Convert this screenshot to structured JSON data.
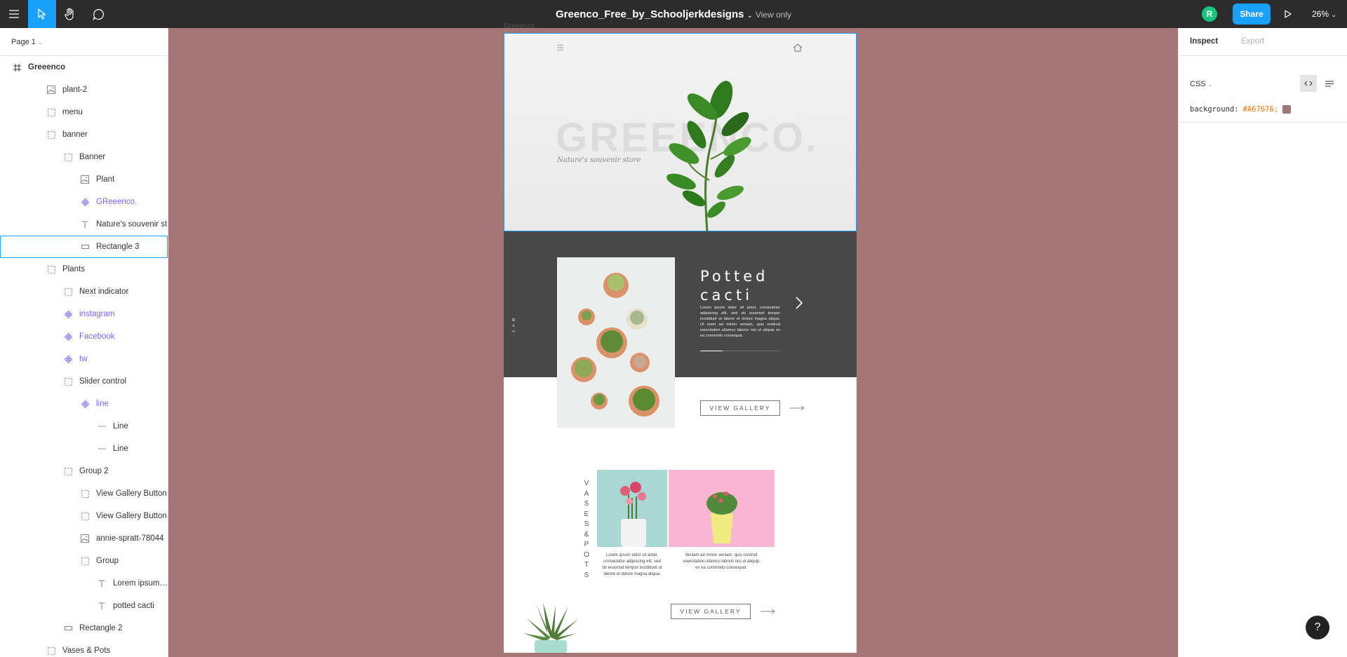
{
  "toolbar": {
    "file_name": "Greenco_Free_by_Schooljerkdesigns",
    "view_mode": "View only",
    "avatar_initial": "R",
    "share_label": "Share",
    "zoom": "26%"
  },
  "layers_panel": {
    "page": "Page 1",
    "items": [
      {
        "label": "Greeenco",
        "icon": "frame-icon",
        "depth": 0
      },
      {
        "label": "plant-2",
        "icon": "image-icon",
        "depth": 1
      },
      {
        "label": "menu",
        "icon": "group-icon",
        "depth": 1
      },
      {
        "label": "banner",
        "icon": "group-icon",
        "depth": 1
      },
      {
        "label": "Banner",
        "icon": "group-icon",
        "depth": 2
      },
      {
        "label": "Plant",
        "icon": "image-icon",
        "depth": 3
      },
      {
        "label": "GReeenco.",
        "icon": "component-icon",
        "depth": 3
      },
      {
        "label": "Nature's souvenir st",
        "icon": "text-icon",
        "depth": 3
      },
      {
        "label": "Rectangle 3",
        "icon": "rectangle-icon",
        "depth": 3
      },
      {
        "label": "Plants",
        "icon": "group-icon",
        "depth": 1
      },
      {
        "label": "Next indicator",
        "icon": "group-icon",
        "depth": 2
      },
      {
        "label": "instagram",
        "icon": "component-icon",
        "depth": 2
      },
      {
        "label": "Facebook",
        "icon": "component-icon",
        "depth": 2
      },
      {
        "label": "tw",
        "icon": "component-icon",
        "depth": 2
      },
      {
        "label": "Slider control",
        "icon": "group-icon",
        "depth": 2
      },
      {
        "label": "line",
        "icon": "component-icon",
        "depth": 3
      },
      {
        "label": "Line",
        "icon": "line-icon",
        "depth": 4
      },
      {
        "label": "Line",
        "icon": "line-icon",
        "depth": 4
      },
      {
        "label": "Group 2",
        "icon": "group-icon",
        "depth": 2
      },
      {
        "label": "View Gallery Button",
        "icon": "group-icon",
        "depth": 3
      },
      {
        "label": "View Gallery Button",
        "icon": "group-icon",
        "depth": 3
      },
      {
        "label": "annie-spratt-78044",
        "icon": "image-icon",
        "depth": 3
      },
      {
        "label": "Group",
        "icon": "group-icon",
        "depth": 3
      },
      {
        "label": "Lorem ipsum dol...",
        "icon": "text-icon",
        "depth": 4
      },
      {
        "label": "potted cacti",
        "icon": "text-icon",
        "depth": 4
      },
      {
        "label": "Rectangle 2",
        "icon": "rectangle-icon",
        "depth": 2
      },
      {
        "label": "Vases & Pots",
        "icon": "group-icon",
        "depth": 1
      }
    ],
    "selected_index": 8,
    "component_color": "#7b61ff"
  },
  "inspect_panel": {
    "tab_inspect": "Inspect",
    "tab_export": "Export",
    "language": "CSS",
    "css_property": "background:",
    "css_value": "#A67676;",
    "swatch_color": "#A67676"
  },
  "canvas": {
    "background": "#A67676",
    "frame_name": "Greeenco",
    "banner": {
      "brand": "GREEENCO.",
      "tagline": "Nature's souvenir store"
    },
    "plants": {
      "title_line1": "Potted",
      "title_line2": "cacti",
      "body": "Lorem ipsum dolor sit amet, consectetur adipiscing elit, sed do eiusmod tempor incididunt ut labore et dolore magna aliqua. Ut enim ad minim veniam, quis nostrud exercitation ullamco laboris nisi ut aliquip ex ea commodo consequat.",
      "slider_progress": 0.28,
      "social": [
        "instagram",
        "Facebook",
        "tw"
      ],
      "gallery_button": "VIEW GALLERY"
    },
    "vases": {
      "label": "VASES&POTS",
      "caption1": "Lorem ipsum dolor sit amet, consectetur adipiscing elit, sed do eiusmod tempor incididunt ut labore et dolore magna aliqua.",
      "caption2": "Veniam ad minim veniam, quis nostrud exercitation ullamco laboris nisi ut aliquip ex ea commodo consequat.",
      "gallery_button": "VIEW GALLERY"
    }
  },
  "help": "?"
}
